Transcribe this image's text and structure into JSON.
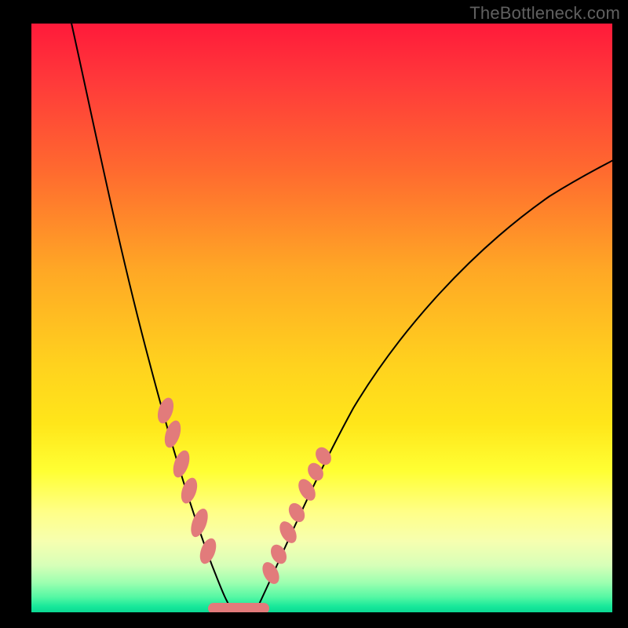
{
  "watermark": "TheBottleneck.com",
  "colors": {
    "frame": "#000000",
    "gradient_top": "#ff1a3a",
    "gradient_bottom": "#0bd893",
    "curve": "#000000",
    "marker": "#e27b7b"
  },
  "chart_data": {
    "type": "line",
    "title": "",
    "xlabel": "",
    "ylabel": "",
    "xlim": [
      0,
      100
    ],
    "ylim": [
      0,
      100
    ],
    "grid": false,
    "legend": false,
    "note": "Axes are unlabeled in the image; values are normalized 0–100 estimates read from pixel positions. y=0 is the green floor (good / no bottleneck), y=100 is the top red edge (severe bottleneck). The curve reaches its minimum near x≈33.",
    "series": [
      {
        "name": "left-branch",
        "x": [
          7,
          10,
          13,
          16,
          19,
          22,
          25,
          28,
          30,
          32,
          33
        ],
        "y": [
          100,
          86,
          72,
          59,
          47,
          36,
          26,
          17,
          10,
          4,
          0
        ]
      },
      {
        "name": "right-branch",
        "x": [
          33,
          36,
          40,
          45,
          50,
          56,
          62,
          70,
          78,
          86,
          94,
          100
        ],
        "y": [
          0,
          6,
          14,
          23,
          32,
          40,
          48,
          56,
          63,
          69,
          74,
          78
        ]
      }
    ],
    "markers": {
      "name": "highlighted-points",
      "description": "Salmon capsule markers clustered near the valley on both branches and a short flat segment at the floor.",
      "left_branch_points": [
        {
          "x": 22,
          "y": 34
        },
        {
          "x": 23,
          "y": 30
        },
        {
          "x": 25,
          "y": 25
        },
        {
          "x": 26,
          "y": 21
        },
        {
          "x": 28,
          "y": 15
        },
        {
          "x": 29,
          "y": 11
        }
      ],
      "right_branch_points": [
        {
          "x": 40,
          "y": 14
        },
        {
          "x": 41,
          "y": 17
        },
        {
          "x": 43,
          "y": 21
        },
        {
          "x": 44,
          "y": 24
        },
        {
          "x": 46,
          "y": 28
        },
        {
          "x": 47,
          "y": 30
        },
        {
          "x": 48,
          "y": 32
        }
      ],
      "floor_segment": {
        "x_start": 30,
        "x_end": 38,
        "y": 0
      }
    }
  }
}
